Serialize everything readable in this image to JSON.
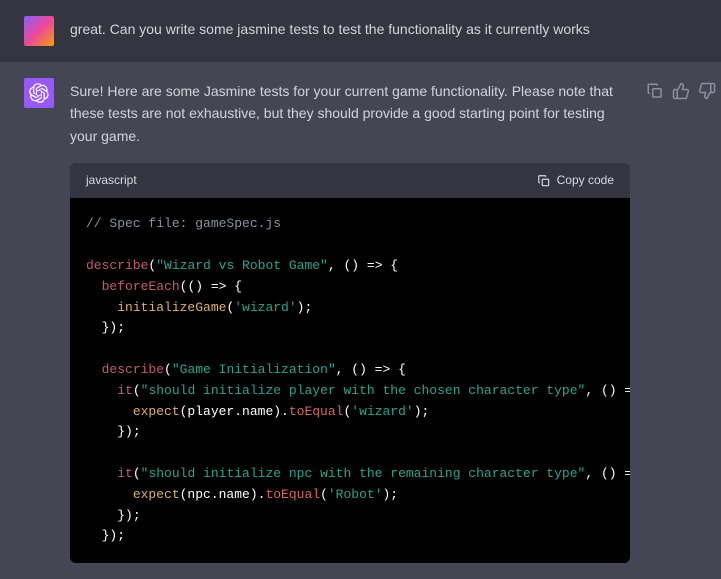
{
  "messages": {
    "user": {
      "text": "great. Can you write some jasmine tests to test the functionality as it currently works"
    },
    "assistant": {
      "text": "Sure! Here are some Jasmine tests for your current game functionality. Please note that these tests are not exhaustive, but they should provide a good starting point for testing your game."
    }
  },
  "code": {
    "lang": "javascript",
    "copy_label": "Copy code",
    "comment": "// Spec file: gameSpec.js",
    "s_desc1": "\"Wizard vs Robot Game\"",
    "s_before": "beforeEach",
    "s_arrow": "() => {",
    "s_init": "initializeGame",
    "s_wizard_sq": "'wizard'",
    "s_close": "});",
    "s_desc": "describe",
    "s_desc2": "\"Game Initialization\"",
    "s_it": "it",
    "s_it1": "\"should initialize player with the chosen character type\"",
    "s_expect": "expect",
    "s_player": "(player.name).",
    "s_toeq": "toEqual",
    "s_wizard2": "'wizard'",
    "s_it2": "\"should initialize npc with the remaining character type\"",
    "s_npc": "(npc.name).",
    "s_robot": "'Robot'"
  }
}
